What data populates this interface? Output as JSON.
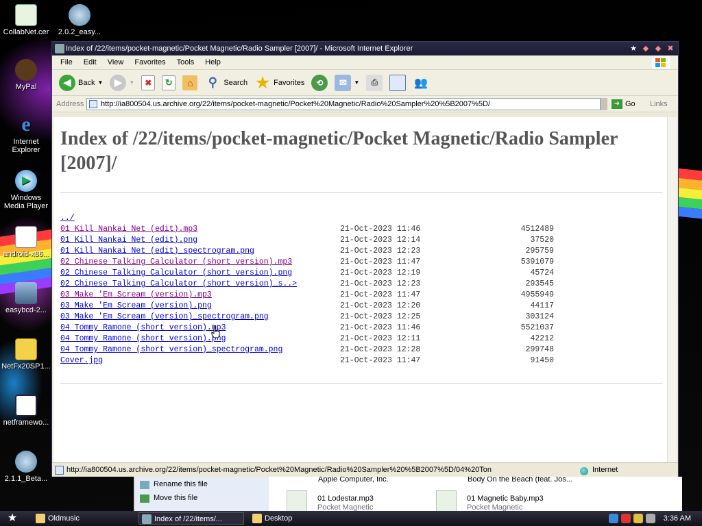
{
  "desktop": {
    "icons": [
      {
        "label": "CollabNet.cer"
      },
      {
        "label": "2.0.2_easy..."
      },
      {
        "label": "MyPal"
      },
      {
        "label": "Internet Explorer"
      },
      {
        "label": "Windows Media Player"
      },
      {
        "label": "android-x86..."
      },
      {
        "label": "easybcd-2..."
      },
      {
        "label": "NetFx20SP1..."
      },
      {
        "label": "netframewo..."
      },
      {
        "label": "2.1.1_Beta..."
      }
    ]
  },
  "window": {
    "title": "Index of /22/items/pocket-magnetic/Pocket Magnetic/Radio Sampler [2007]/ - Microsoft Internet Explorer",
    "menu": [
      "File",
      "Edit",
      "View",
      "Favorites",
      "Tools",
      "Help"
    ],
    "toolbar": {
      "back": "Back",
      "search": "Search",
      "favorites": "Favorites"
    },
    "address": {
      "label": "Address",
      "url": "http://ia800504.us.archive.org/22/items/pocket-magnetic/Pocket%20Magnetic/Radio%20Sampler%20%5B2007%5D/",
      "go": "Go",
      "links": "Links"
    },
    "status": {
      "text": "http://ia800504.us.archive.org/22/items/pocket-magnetic/Pocket%20Magnetic/Radio%20Sampler%20%5B2007%5D/04%20Ton",
      "zone": "Internet"
    }
  },
  "page": {
    "title": "Index of /22/items/pocket-magnetic/Pocket Magnetic/Radio Sampler [2007]/",
    "parent_link": "../",
    "files": [
      {
        "name": "01 Kill Nankai Net (edit).mp3",
        "date": "21-Oct-2023 11:46",
        "size": "4512489",
        "visited": true
      },
      {
        "name": "01 Kill Nankai Net (edit).png",
        "date": "21-Oct-2023 12:14",
        "size": "37520",
        "visited": false
      },
      {
        "name": "01 Kill Nankai Net (edit)_spectrogram.png",
        "date": "21-Oct-2023 12:23",
        "size": "295759",
        "visited": false
      },
      {
        "name": "02 Chinese Talking Calculator (short version).mp3",
        "date": "21-Oct-2023 11:47",
        "size": "5391079",
        "visited": true
      },
      {
        "name": "02 Chinese Talking Calculator (short version).png",
        "date": "21-Oct-2023 12:19",
        "size": "45724",
        "visited": false
      },
      {
        "name": "02 Chinese Talking Calculator (short version)_s..>",
        "date": "21-Oct-2023 12:23",
        "size": "293545",
        "visited": false
      },
      {
        "name": "03 Make 'Em Scream (version).mp3",
        "date": "21-Oct-2023 11:47",
        "size": "4955949",
        "visited": true
      },
      {
        "name": "03 Make 'Em Scream (version).png",
        "date": "21-Oct-2023 12:20",
        "size": "44117",
        "visited": false
      },
      {
        "name": "03 Make 'Em Scream (version)_spectrogram.png",
        "date": "21-Oct-2023 12:25",
        "size": "303124",
        "visited": false
      },
      {
        "name": "04 Tommy Ramone (short version).mp3",
        "date": "21-Oct-2023 11:46",
        "size": "5521037",
        "visited": false
      },
      {
        "name": "04 Tommy Ramone (short version).png",
        "date": "21-Oct-2023 12:11",
        "size": "42212",
        "visited": false
      },
      {
        "name": "04 Tommy Ramone (short version)_spectrogram.png",
        "date": "21-Oct-2023 12:28",
        "size": "299748",
        "visited": false
      },
      {
        "name": "Cover.jpg",
        "date": "21-Oct-2023 11:47",
        "size": "91450",
        "visited": false
      }
    ]
  },
  "explorer": {
    "tasks": [
      "Rename this file",
      "Move this file"
    ],
    "header_items": [
      "Apple Computer, Inc.",
      "Body On the Beach (feat. Jos..."
    ],
    "files": [
      {
        "name": "01 Lodestar.mp3",
        "sub": "Pocket Magnetic"
      },
      {
        "name": "01 Magnetic Baby.mp3",
        "sub": "Pocket Magnetic"
      }
    ]
  },
  "taskbar": {
    "buttons": [
      "Oldmusic",
      "Index of /22/items/...",
      "Desktop"
    ],
    "clock": "3:36 AM"
  }
}
